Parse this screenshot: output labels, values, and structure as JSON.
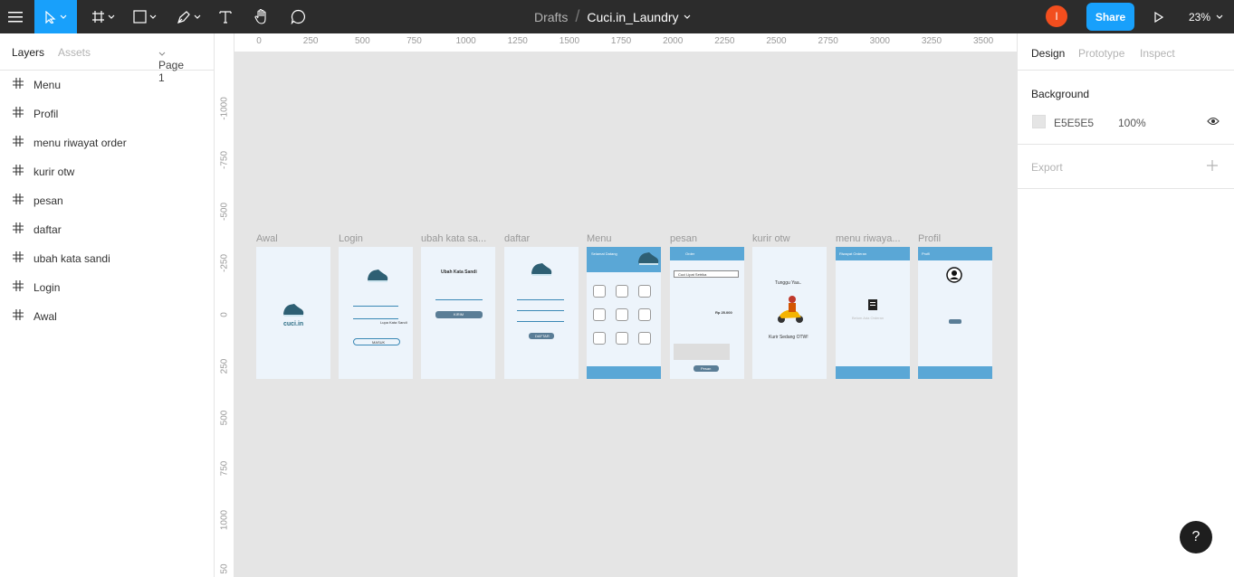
{
  "toolbar": {
    "breadcrumb_root": "Drafts",
    "file_name": "Cuci.in_Laundry",
    "avatar_initial": "I",
    "share_label": "Share",
    "zoom_level": "23%"
  },
  "left_panel": {
    "tab_layers": "Layers",
    "tab_assets": "Assets",
    "page_selector": "Page 1",
    "layers": [
      "Menu",
      "Profil",
      "menu riwayat order",
      "kurir otw",
      "pesan",
      "daftar",
      "ubah kata sandi",
      "Login",
      "Awal"
    ]
  },
  "right_panel": {
    "tab_design": "Design",
    "tab_prototype": "Prototype",
    "tab_inspect": "Inspect",
    "background_heading": "Background",
    "bg_hex": "E5E5E5",
    "bg_opacity": "100%",
    "export_heading": "Export"
  },
  "canvas": {
    "hruler": [
      "0",
      "250",
      "500",
      "750",
      "1000",
      "1250",
      "1500",
      "1750",
      "2000",
      "2250",
      "2500",
      "2750",
      "3000",
      "3250",
      "3500"
    ],
    "vruler": [
      "-1000",
      "-750",
      "-500",
      "-250",
      "0",
      "250",
      "500",
      "750",
      "1000",
      "50"
    ],
    "frames": [
      "Awal",
      "Login",
      "ubah kata sa...",
      "daftar",
      "Menu",
      "pesan",
      "kurir otw",
      "menu riwaya...",
      "Profil"
    ]
  },
  "mockups": {
    "logo": "cuci.in",
    "lupa": "Lupa Kata Sandi",
    "masuk": "MASUK",
    "ubah_title": "Ubah Kata Sandi",
    "kirim": "KIRIM",
    "daftar_btn": "DAFTAR",
    "greeting": "Selamat Datang",
    "order": "Order",
    "cuci": "Cuci Lipat Setrika",
    "harga": "Rp 25.000",
    "pesan_btn": "Pesan",
    "tunggu": "Tunggu Yaa..",
    "kurir": "Kurir Sedang OTW!",
    "riwayat": "Riwayat Orderan",
    "belum": "Belum Ada Orderan",
    "profil": "Profil"
  },
  "help_label": "?"
}
